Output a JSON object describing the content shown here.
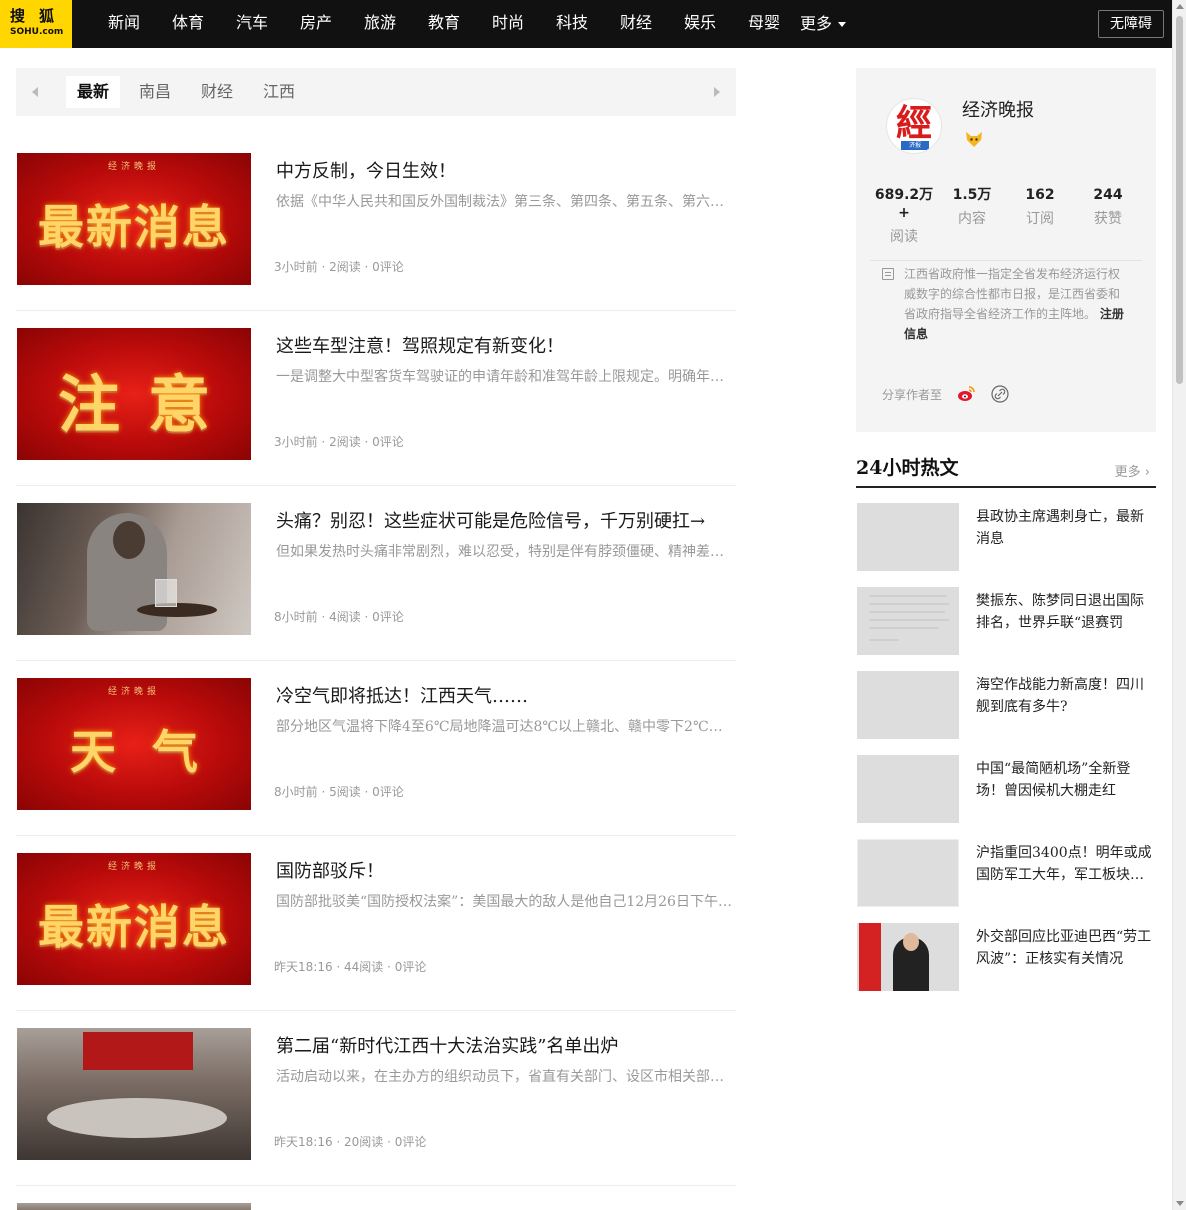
{
  "brand": {
    "logo_cn": "搜狐",
    "logo_en": "SOHU.com",
    "accent": "#ffd600"
  },
  "nav": {
    "items": [
      "新闻",
      "体育",
      "汽车",
      "房产",
      "旅游",
      "教育",
      "时尚",
      "科技",
      "财经",
      "娱乐",
      "母婴"
    ],
    "more": "更多",
    "accessibility": "无障碍"
  },
  "tabs": [
    "最新",
    "南昌",
    "财经",
    "江西"
  ],
  "active_tab": "最新",
  "articles": [
    {
      "title": "中方反制，今日生效！",
      "summary": "依据《中华人民共和国反外国制裁法》第三条、第四条、第五条、第六条…",
      "meta": "3小时前 · 2阅读 · 0评论",
      "thumb_text": "最新消息"
    },
    {
      "title": "这些车型注意！驾照规定有新变化！",
      "summary": "一是调整大中型客货车驾驶证的申请年龄和准驾年龄上限规定。明确年…",
      "meta": "3小时前 · 2阅读 · 0评论",
      "thumb_text": "注意"
    },
    {
      "title": "头痛？别忍！这些症状可能是危险信号，千万别硬扛→",
      "summary": "但如果发热时头痛非常剧烈，难以忍受，特别是伴有脖颈僵硬、精神差…",
      "meta": "8小时前 · 4阅读 · 0评论"
    },
    {
      "title": "冷空气即将抵达！江西天气……",
      "summary": "部分地区气温将下降4至6℃局地降温可达8℃以上赣北、赣中零下2℃～0…",
      "meta": "8小时前 · 5阅读 · 0评论",
      "thumb_text": "天气"
    },
    {
      "title": "国防部驳斥！",
      "summary": "国防部批驳美“国防授权法案”：美国最大的敌人是他自己12月26日下午…",
      "meta": "昨天18:16 · 44阅读 · 0评论",
      "thumb_text": "最新消息"
    },
    {
      "title": "第二届“新时代江西十大法治实践”名单出炉",
      "summary": "活动启动以来，在主办方的组织动员下，省直有关部门、设区市相关部…",
      "meta": "昨天18:16 · 20阅读 · 0评论"
    }
  ],
  "thumb_paper_name": "经济晚报",
  "author": {
    "name": "经济晚报",
    "avatar_char": "經",
    "avatar_sub": "济报",
    "stats": [
      {
        "num": "689.2万+",
        "label": "阅读"
      },
      {
        "num": "1.5万",
        "label": "内容"
      },
      {
        "num": "162",
        "label": "订阅"
      },
      {
        "num": "244",
        "label": "获赞"
      }
    ],
    "description": "江西省政府惟一指定全省发布经济运行权威数字的综合性都市日报，是江西省委和省政府指导全省经济工作的主阵地。",
    "register_link": "注册信息",
    "share_label": "分享作者至"
  },
  "hot": {
    "title": "24小时热文",
    "more": "更多",
    "items": [
      "县政协主席遇刺身亡，最新消息",
      "樊振东、陈梦同日退出国际排名，世界乒联“退赛罚款”…",
      "海空作战能力新高度！四川舰到底有多牛?",
      "中国“最简陋机场”全新登场！曾因候机大棚走红",
      "沪指重回3400点！明年或成国防军工大年，军工板块…",
      "外交部回应比亚迪巴西“劳工风波”：正核实有关情况"
    ]
  }
}
